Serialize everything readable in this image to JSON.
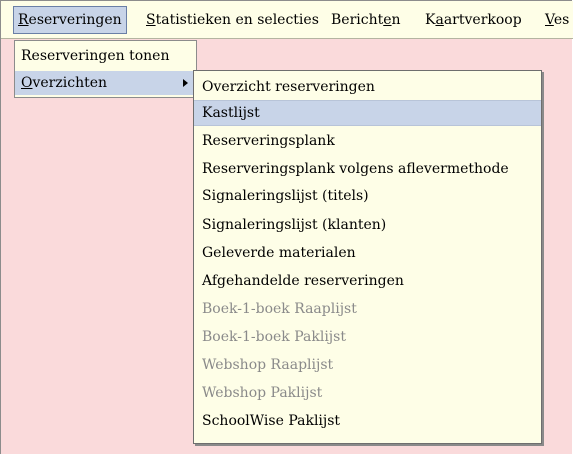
{
  "menubar": {
    "items": [
      {
        "pre": "",
        "acc": "R",
        "post": "eserveringen"
      },
      {
        "pre": "",
        "acc": "S",
        "post": "tatistieken en selecties"
      },
      {
        "pre": "Bericht",
        "acc": "e",
        "post": "n"
      },
      {
        "pre": "K",
        "acc": "a",
        "post": "artverkoop"
      },
      {
        "pre": "",
        "acc": "V",
        "post": "es"
      }
    ]
  },
  "menu1": {
    "items": [
      {
        "label": "Reserveringen tonen"
      },
      {
        "acc": "O",
        "post": "verzichten"
      }
    ]
  },
  "menu2": {
    "items": [
      {
        "label": "Overzicht reserveringen",
        "enabled": true
      },
      {
        "label": "Kastlijst",
        "enabled": true
      },
      {
        "label": "Reserveringsplank",
        "enabled": true
      },
      {
        "label": "Reserveringsplank volgens aflevermethode",
        "enabled": true
      },
      {
        "label": "Signaleringslijst (titels)",
        "enabled": true
      },
      {
        "label": "Signaleringslijst (klanten)",
        "enabled": true
      },
      {
        "label": "Geleverde materialen",
        "enabled": true
      },
      {
        "label": "Afgehandelde reserveringen",
        "enabled": true
      },
      {
        "label": "Boek-1-boek Raaplijst",
        "enabled": false
      },
      {
        "label": "Boek-1-boek Paklijst",
        "enabled": false
      },
      {
        "label": "Webshop Raaplijst",
        "enabled": false
      },
      {
        "label": "Webshop Paklijst",
        "enabled": false
      },
      {
        "label": "SchoolWise Paklijst",
        "enabled": true
      }
    ]
  }
}
